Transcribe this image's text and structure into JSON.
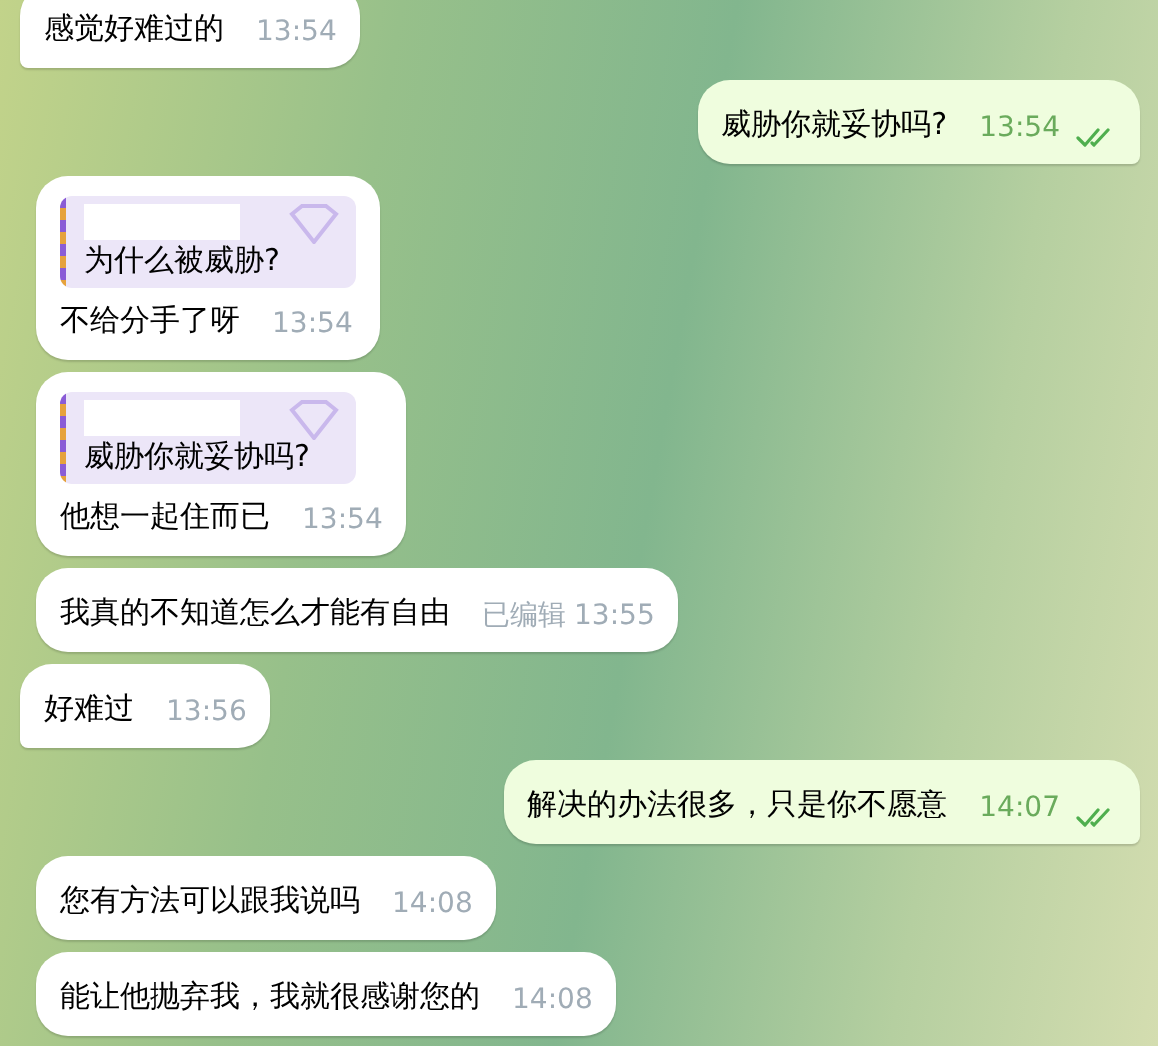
{
  "messages": [
    {
      "kind": "incoming",
      "text": "感觉好难过的",
      "time": "13:54",
      "tail": true
    },
    {
      "kind": "outgoing",
      "text": "威胁你就妥协吗?",
      "time": "13:54",
      "read": true,
      "tail": true
    },
    {
      "kind": "incoming",
      "reply": "为什么被威胁?",
      "text": "不给分手了呀",
      "time": "13:54",
      "tail": false
    },
    {
      "kind": "incoming",
      "reply": "威胁你就妥协吗?",
      "text": "他想一起住而已",
      "time": "13:54",
      "tail": false
    },
    {
      "kind": "incoming",
      "text": "我真的不知道怎么才能有自由",
      "edited": "已编辑",
      "time": "13:55",
      "tail": false
    },
    {
      "kind": "incoming",
      "text": "好难过",
      "time": "13:56",
      "tail": true
    },
    {
      "kind": "outgoing",
      "text": "解决的办法很多，只是你不愿意",
      "time": "14:07",
      "read": true,
      "tail": true
    },
    {
      "kind": "incoming",
      "text": "您有方法可以跟我说吗",
      "time": "14:08",
      "tail": false
    },
    {
      "kind": "incoming",
      "text": "能让他抛弃我，我就很感谢您的",
      "time": "14:08",
      "tail": false
    }
  ]
}
